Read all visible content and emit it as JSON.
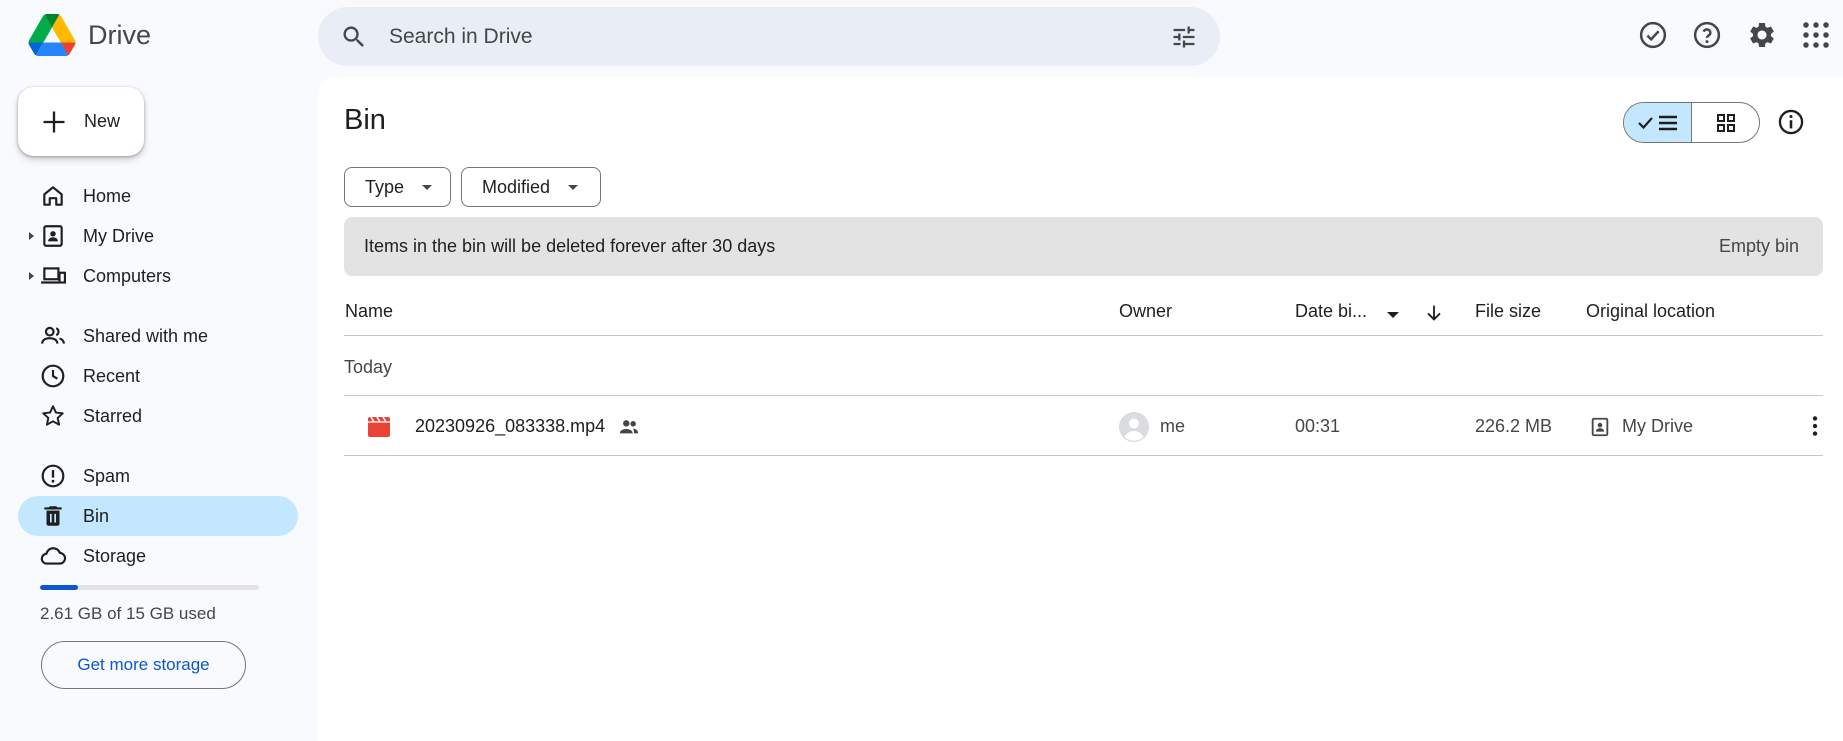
{
  "app": {
    "name": "Drive"
  },
  "search": {
    "placeholder": "Search in Drive"
  },
  "top_icons": [
    "ready-for-offline-icon",
    "help-icon",
    "settings-icon",
    "apps-grid-icon"
  ],
  "sidebar": {
    "new_label": "New",
    "items": [
      {
        "label": "Home",
        "icon": "home-icon",
        "expandable": false,
        "active": false
      },
      {
        "label": "My Drive",
        "icon": "my-drive-icon",
        "expandable": true,
        "active": false
      },
      {
        "label": "Computers",
        "icon": "computers-icon",
        "expandable": true,
        "active": false
      },
      {
        "label": "Shared with me",
        "icon": "shared-icon",
        "expandable": false,
        "active": false
      },
      {
        "label": "Recent",
        "icon": "clock-icon",
        "expandable": false,
        "active": false
      },
      {
        "label": "Starred",
        "icon": "star-icon",
        "expandable": false,
        "active": false
      },
      {
        "label": "Spam",
        "icon": "spam-icon",
        "expandable": false,
        "active": false
      },
      {
        "label": "Bin",
        "icon": "bin-icon",
        "expandable": false,
        "active": true
      },
      {
        "label": "Storage",
        "icon": "cloud-icon",
        "expandable": false,
        "active": false
      }
    ],
    "storage": {
      "used_text": "2.61 GB of 15 GB used",
      "fraction_used": 0.174,
      "button_label": "Get more storage"
    }
  },
  "main": {
    "title": "Bin",
    "filters": [
      {
        "label": "Type"
      },
      {
        "label": "Modified"
      }
    ],
    "banner": {
      "text": "Items in the bin will be deleted forever after 30 days",
      "action_label": "Empty bin"
    },
    "columns": {
      "name": "Name",
      "owner": "Owner",
      "date": "Date bi...",
      "size": "File size",
      "location": "Original location"
    },
    "group_label": "Today",
    "files": [
      {
        "name": "20230926_083338.mp4",
        "owner": "me",
        "date": "00:31",
        "size": "226.2 MB",
        "location": "My Drive",
        "type": "video",
        "shared": true
      }
    ]
  },
  "colors": {
    "accent": "#0b57d0",
    "active_bg": "#c2e7ff",
    "video_red": "#ea4335",
    "page_bg": "#f8fafd"
  }
}
